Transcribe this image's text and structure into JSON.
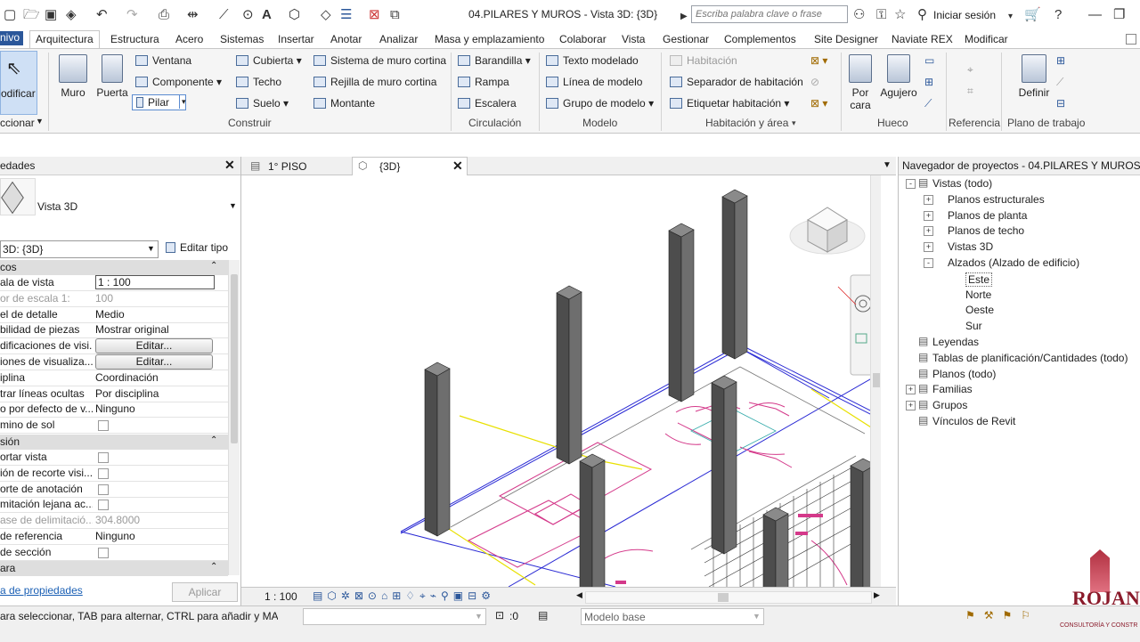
{
  "titlebar": {
    "title": "04.PILARES Y MUROS - Vista 3D: {3D}",
    "search_placeholder": "Escriba palabra clave o frase",
    "signin": "Iniciar sesión"
  },
  "menu": {
    "tabs": [
      "nivo",
      "Arquitectura",
      "Estructura",
      "Acero",
      "Sistemas",
      "Insertar",
      "Anotar",
      "Analizar",
      "Masa y emplazamiento",
      "Colaborar",
      "Vista",
      "Gestionar",
      "Complementos",
      "Site Designer",
      "Naviate REX",
      "Modificar"
    ]
  },
  "ribbon": {
    "modify_label": "odificar",
    "select_label": "ccionar",
    "muro": "Muro",
    "puerta": "Puerta",
    "ventana": "Ventana",
    "componente": "Componente",
    "pilar": "Pilar",
    "cubierta": "Cubierta",
    "techo": "Techo",
    "suelo": "Suelo",
    "sistema_muro": "Sistema de muro cortina",
    "rejilla_muro": "Rejilla de muro cortina",
    "montante": "Montante",
    "barandilla": "Barandilla",
    "rampa": "Rampa",
    "escalera": "Escalera",
    "texto_modelado": "Texto modelado",
    "linea_modelo": "Línea de modelo",
    "grupo_modelo": "Grupo de modelo",
    "habitacion": "Habitación",
    "separador": "Separador de habitación",
    "etiquetar": "Etiquetar  habitación",
    "por_cara": "Por\ncara",
    "agujero": "Agujero",
    "definir": "Definir",
    "panels": {
      "construir": "Construir",
      "circulacion": "Circulación",
      "modelo": "Modelo",
      "habitacion_area": "Habitación y área",
      "hueco": "Hueco",
      "referencia": "Referencia",
      "plano_trabajo": "Plano de trabajo"
    }
  },
  "properties": {
    "header": "edades",
    "type_name": "Vista 3D",
    "selector": "3D: {3D}",
    "edit_type": "Editar tipo",
    "sections": [
      "cos",
      "sión",
      "ara"
    ],
    "rows": [
      {
        "k": "ala de vista",
        "v": "1 : 100"
      },
      {
        "k": "or de escala    1:",
        "v": "100",
        "dim": true
      },
      {
        "k": "el de detalle",
        "v": "Medio"
      },
      {
        "k": "bilidad de piezas",
        "v": "Mostrar original"
      },
      {
        "k": "dificaciones de visi...",
        "v": "Editar...",
        "button": true
      },
      {
        "k": "iones de visualiza...",
        "v": "Editar...",
        "button": true
      },
      {
        "k": "iplina",
        "v": "Coordinación"
      },
      {
        "k": "trar líneas ocultas",
        "v": "Por disciplina"
      },
      {
        "k": "o por defecto de v...",
        "v": "Ninguno"
      },
      {
        "k": "mino de sol",
        "v": "",
        "check": true
      }
    ],
    "rows2": [
      {
        "k": "ortar vista",
        "check": true
      },
      {
        "k": "ión de recorte visi...",
        "check": true
      },
      {
        "k": "orte de anotación",
        "check": true
      },
      {
        "k": "mitación lejana ac...",
        "check": true
      },
      {
        "k": "ase de delimitació...",
        "v": "304.8000",
        "dim": true
      },
      {
        "k": "de referencia",
        "v": "Ninguno"
      },
      {
        "k": "de sección",
        "check": true
      }
    ],
    "help_link": "a de propiedades",
    "apply": "Aplicar"
  },
  "view": {
    "tabs": [
      "1° PISO",
      "{3D}"
    ],
    "scale": "1 : 100"
  },
  "browser": {
    "header": "Navegador de proyectos - 04.PILARES Y MUROS",
    "items": [
      {
        "label": "Vistas (todo)",
        "level": 0,
        "toggle": "-"
      },
      {
        "label": "Planos estructurales",
        "level": 1,
        "toggle": "+"
      },
      {
        "label": "Planos de planta",
        "level": 1,
        "toggle": "+"
      },
      {
        "label": "Planos de techo",
        "level": 1,
        "toggle": "+"
      },
      {
        "label": "Vistas 3D",
        "level": 1,
        "toggle": "+"
      },
      {
        "label": "Alzados (Alzado de edificio)",
        "level": 1,
        "toggle": "-"
      },
      {
        "label": "Este",
        "level": 2,
        "selected": true
      },
      {
        "label": "Norte",
        "level": 2
      },
      {
        "label": "Oeste",
        "level": 2
      },
      {
        "label": "Sur",
        "level": 2
      },
      {
        "label": "Leyendas",
        "level": 0
      },
      {
        "label": "Tablas de planificación/Cantidades (todo)",
        "level": 0
      },
      {
        "label": "Planos (todo)",
        "level": 0
      },
      {
        "label": "Familias",
        "level": 0,
        "toggle": "+"
      },
      {
        "label": "Grupos",
        "level": 0,
        "toggle": "+"
      },
      {
        "label": "Vínculos de Revit",
        "level": 0
      }
    ]
  },
  "status": {
    "hint": "ara seleccionar, TAB para alternar, CTRL para añadir y MAYÚ",
    "zero": ":0",
    "model": "Modelo base",
    "watermark": "ROJAN",
    "watermark_sub": "CONSULTORÍA Y CONSTR"
  },
  "colors": {
    "accent": "#2b579a",
    "pillar": "#555555",
    "plan_magenta": "#d4398a",
    "plan_blue": "#2a2ad4",
    "plan_yellow": "#e8e000"
  }
}
